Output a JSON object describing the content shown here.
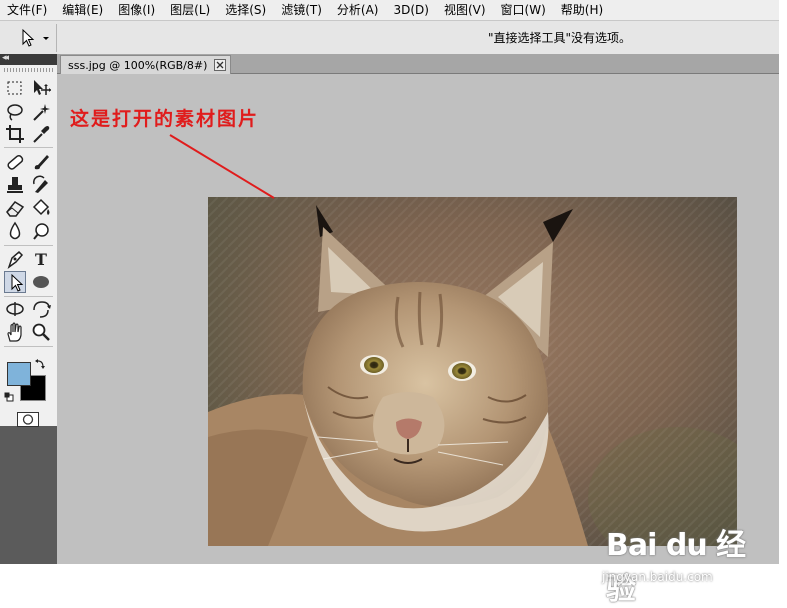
{
  "menu": [
    "文件(F)",
    "编辑(E)",
    "图像(I)",
    "图层(L)",
    "选择(S)",
    "滤镜(T)",
    "分析(A)",
    "3D(D)",
    "视图(V)",
    "窗口(W)",
    "帮助(H)"
  ],
  "options_bar": {
    "tool_icon": "direct-selection-icon",
    "message": "\"直接选择工具\"没有选项。"
  },
  "document": {
    "tab_label": "sss.jpg @ 100%(RGB/8#)"
  },
  "annotation": {
    "text": "这是打开的素材图片",
    "color": "#e01c1c"
  },
  "toolbox": {
    "tools": [
      "rectangular-marquee-icon",
      "move-icon",
      "lasso-icon",
      "magic-wand-icon",
      "crop-icon",
      "eyedropper-icon",
      "healing-brush-icon",
      "brush-icon",
      "clone-stamp-icon",
      "history-brush-icon",
      "eraser-icon",
      "paint-bucket-icon",
      "blur-icon",
      "dodge-icon",
      "pen-icon",
      "type-icon",
      "direct-selection-icon",
      "ellipse-icon",
      "rotate-3d-icon",
      "orbit-3d-icon",
      "hand-icon",
      "zoom-icon"
    ],
    "type_tool_label": "T",
    "foreground_color": "#7fb3da",
    "background_color": "#000000"
  },
  "watermark": {
    "brand": "Bai du 经验",
    "url": "jingyan.baidu.com"
  }
}
